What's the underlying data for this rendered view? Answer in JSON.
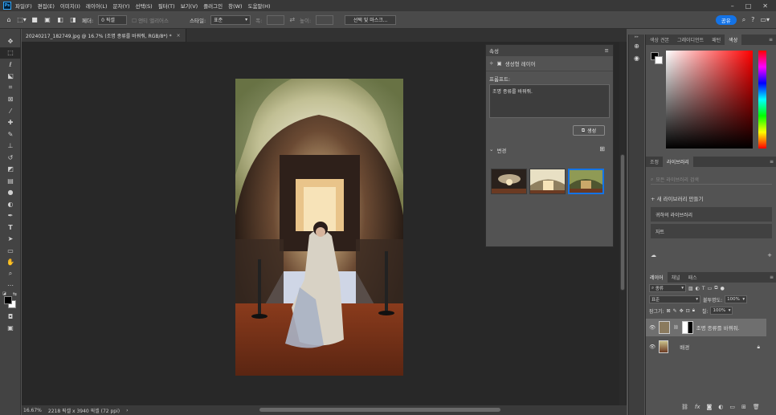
{
  "app": {
    "logo": "Ps"
  },
  "menu": [
    "파일(F)",
    "편집(E)",
    "이미지(I)",
    "레이어(L)",
    "문자(Y)",
    "선택(S)",
    "필터(T)",
    "보기(V)",
    "플러그인",
    "창(W)",
    "도움말(H)"
  ],
  "window_controls": {
    "minimize": "–",
    "maximize": "□",
    "close": "✕"
  },
  "options": {
    "feather_label": "페더:",
    "feather_value": "0 픽셀",
    "antialias": "앤티 앨리어스",
    "style_label": "스타일:",
    "style_value": "표준",
    "width_label": "폭:",
    "height_label": "높이:",
    "select_mask": "선택 및 마스크...",
    "share": "공유"
  },
  "document": {
    "tab_title": "20240217_182749.jpg @ 16.7% (조명 종류를 바꿔줘, RGB/8*) *",
    "zoom": "16.67%",
    "size_info": "2218 픽셀 x 3940 픽셀 (72 ppi)"
  },
  "properties": {
    "title": "속성",
    "layer_type": "생성형 레이어",
    "prompt_label": "프롬프트:",
    "prompt_text": "조명 종류를 바꿔줘.",
    "generate_label": "생성",
    "variations_label": "변경"
  },
  "color_panel": {
    "tabs": [
      "색상 견본",
      "그레이디언트",
      "패턴",
      "색상"
    ],
    "active_tab": 3
  },
  "library_panel": {
    "tabs": [
      "조정",
      "라이브러리"
    ],
    "active_tab": 1,
    "search_placeholder": "모든 라이브러리 검색",
    "new_library": "+ 새 라이브러리 만들기",
    "items": [
      "귀하의 라이브러리",
      "자트"
    ]
  },
  "layers_panel": {
    "tabs": [
      "레이어",
      "채널",
      "패스"
    ],
    "filter_value": "종류",
    "blend_mode": "표준",
    "opacity_label": "불투명도:",
    "opacity_value": "100%",
    "lock_label": "잠그기:",
    "fill_label": "칠:",
    "fill_value": "100%",
    "layers": [
      {
        "name": "조명 종류를 바꿔줘.",
        "selected": true
      },
      {
        "name": "배경",
        "selected": false
      }
    ]
  },
  "colors": {
    "accent": "#1473e6",
    "selection": "#1473e6"
  }
}
